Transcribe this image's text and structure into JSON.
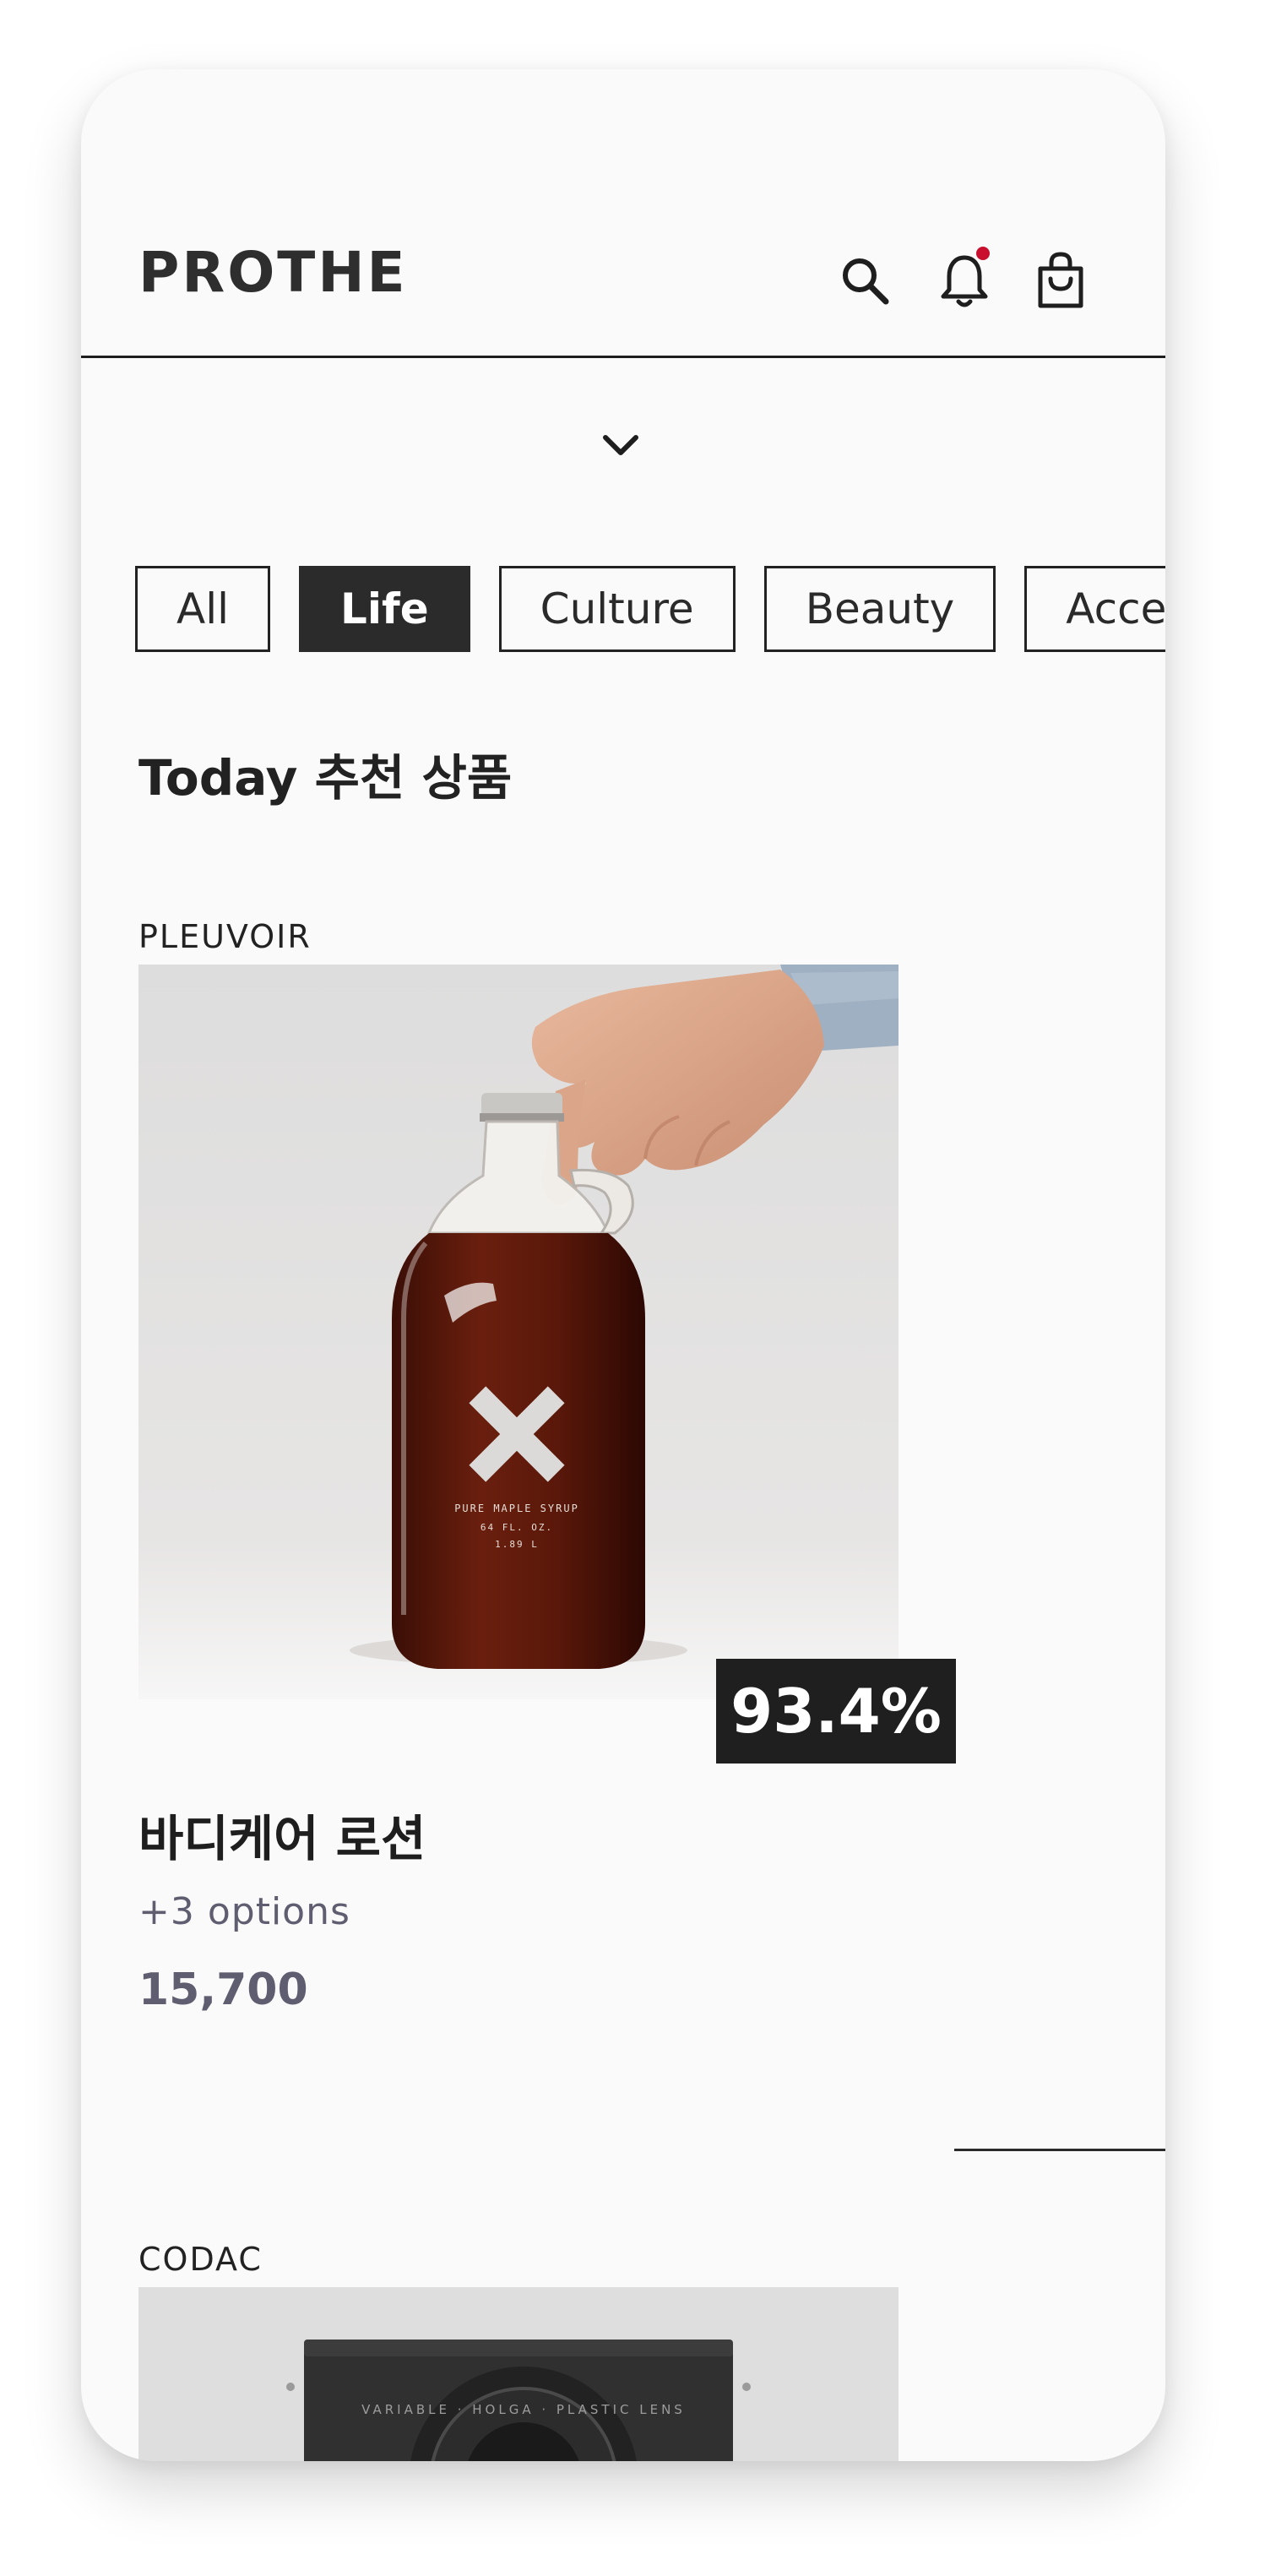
{
  "app": {
    "logo": "PROTHE"
  },
  "header": {
    "icons": [
      "search-icon",
      "bell-icon",
      "shopping-bag-icon"
    ],
    "has_notification": true
  },
  "colors": {
    "background": "#fafafa",
    "text": "#222222",
    "active_chip": "#2b2b2b",
    "notification_dot": "#c8102e",
    "muted_text": "#5f5d70"
  },
  "filters": {
    "chips": [
      {
        "label": "All",
        "active": false
      },
      {
        "label": "Life",
        "active": true
      },
      {
        "label": "Culture",
        "active": false
      },
      {
        "label": "Beauty",
        "active": false
      },
      {
        "label": "Accessories",
        "active": false
      }
    ]
  },
  "section": {
    "title": "Today 추천 상품"
  },
  "products": [
    {
      "brand": "PLEUVOIR",
      "bottle_label": [
        "PURE MAPLE SYRUP",
        "64 FL. OZ.",
        "1.89 L"
      ],
      "badge": "93.4%",
      "name": "바디케어 로션",
      "options": "+3 options",
      "price": "15,700"
    },
    {
      "brand": "CODAC",
      "lens_text": "VARIABLE · HOLGA · PLASTIC LENS"
    }
  ]
}
